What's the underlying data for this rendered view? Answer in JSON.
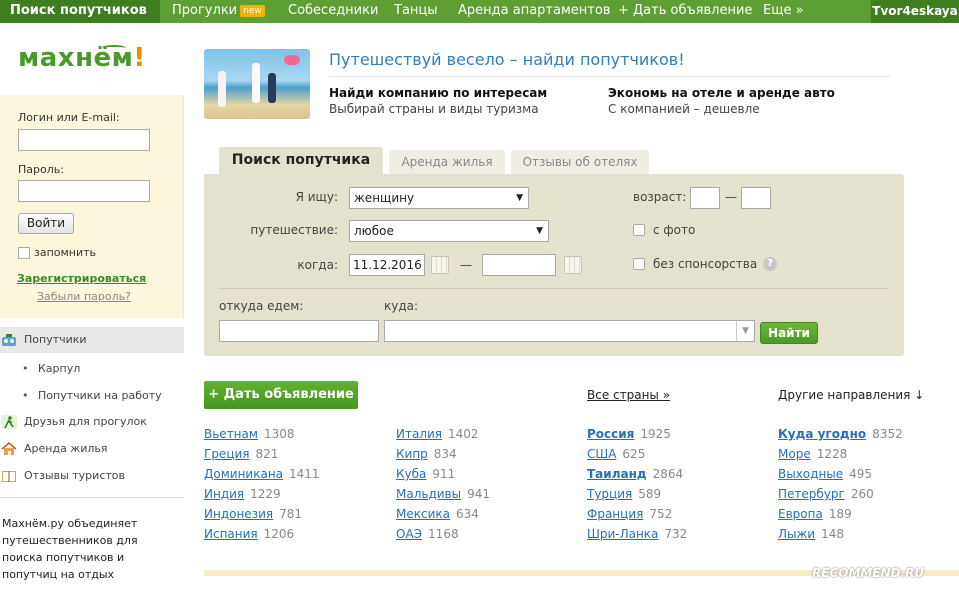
{
  "topnav": {
    "items": [
      "Поиск попутчиков",
      "Прогулки",
      "Собеседники",
      "Танцы",
      "Аренда апартаментов",
      "+ Дать объявление",
      "Еще »"
    ],
    "badge_new": "new",
    "user": "Tvor4eskaya"
  },
  "logo": {
    "text": "махнём",
    "excl": "!"
  },
  "login": {
    "login_label": "Логин или E-mail:",
    "password_label": "Пароль:",
    "login_button": "Войти",
    "remember_label": "запомнить",
    "register_link": "Зарегистрироваться",
    "forgot_link": "Забыли пароль?"
  },
  "sidebar": {
    "items": [
      {
        "label": "Попутчики",
        "icon": "travelers-icon"
      },
      {
        "label": "Друзья для прогулок",
        "icon": "walker-icon"
      },
      {
        "label": "Аренда жилья",
        "icon": "house-icon"
      },
      {
        "label": "Отзывы туристов",
        "icon": "book-icon"
      }
    ],
    "subitems": [
      "Карпул",
      "Попутчики на работу"
    ],
    "about": "Махнём.ру объединяет путешественников для поиска попутчиков и попутчиц на отдых"
  },
  "header": {
    "tagline": "Путешествуй весело – найди попутчиков!",
    "feature1_title": "Найди компанию по интересам",
    "feature1_sub": "Выбирай страны и виды туризма",
    "feature2_title": "Экономь на отеле и аренде авто",
    "feature2_sub": "С компанией – дешевле"
  },
  "tabs": [
    "Поиск попутчика",
    "Аренда жилья",
    "Отзывы об отелях"
  ],
  "search": {
    "seek_label": "Я ищу:",
    "seek_value": "женщину",
    "trip_label": "путешествие:",
    "trip_value": "любое",
    "when_label": "когда:",
    "date_from": "11.12.2016",
    "dash": "—",
    "age_label": "возраст:",
    "photo_label": "с фото",
    "nosponsor_label": "без спонсорства",
    "help": "?",
    "from_label": "откуда едем:",
    "to_label": "куда:",
    "find_button": "Найти"
  },
  "countries_block": {
    "add_button": "+ Дать объявление",
    "all_countries": "Все страны »",
    "other_destinations": "Другие направления ↓",
    "columns": [
      [
        {
          "name": "Вьетнам",
          "count": "1308",
          "bold": false
        },
        {
          "name": "Греция",
          "count": "821",
          "bold": false
        },
        {
          "name": "Доминикана",
          "count": "1411",
          "bold": false
        },
        {
          "name": "Индия",
          "count": "1229",
          "bold": false
        },
        {
          "name": "Индонезия",
          "count": "781",
          "bold": false
        },
        {
          "name": "Испания",
          "count": "1206",
          "bold": false
        }
      ],
      [
        {
          "name": "Италия",
          "count": "1402",
          "bold": false
        },
        {
          "name": "Кипр",
          "count": "834",
          "bold": false
        },
        {
          "name": "Куба",
          "count": "911",
          "bold": false
        },
        {
          "name": "Мальдивы",
          "count": "941",
          "bold": false
        },
        {
          "name": "Мексика",
          "count": "634",
          "bold": false
        },
        {
          "name": "ОАЭ",
          "count": "1168",
          "bold": false
        }
      ],
      [
        {
          "name": "Россия",
          "count": "1925",
          "bold": true
        },
        {
          "name": "США",
          "count": "625",
          "bold": false
        },
        {
          "name": "Таиланд",
          "count": "2864",
          "bold": true
        },
        {
          "name": "Турция",
          "count": "589",
          "bold": false
        },
        {
          "name": "Франция",
          "count": "752",
          "bold": false
        },
        {
          "name": "Шри-Ланка",
          "count": "732",
          "bold": false
        }
      ],
      [
        {
          "name": "Куда угодно",
          "count": "8352",
          "bold": true
        },
        {
          "name": "Море",
          "count": "1228",
          "bold": false
        },
        {
          "name": "Выходные",
          "count": "495",
          "bold": false
        },
        {
          "name": "Петербург",
          "count": "260",
          "bold": false
        },
        {
          "name": "Европа",
          "count": "189",
          "bold": false
        },
        {
          "name": "Лыжи",
          "count": "148",
          "bold": false
        }
      ]
    ]
  },
  "watermark": "RECOMMEND.RU",
  "colors": {
    "brand_green": "#5ca033",
    "dark_green": "#3d7f1e",
    "link_blue": "#2a6fb3",
    "accent_orange": "#f08a00",
    "panel_beige": "#e5e1cf"
  }
}
